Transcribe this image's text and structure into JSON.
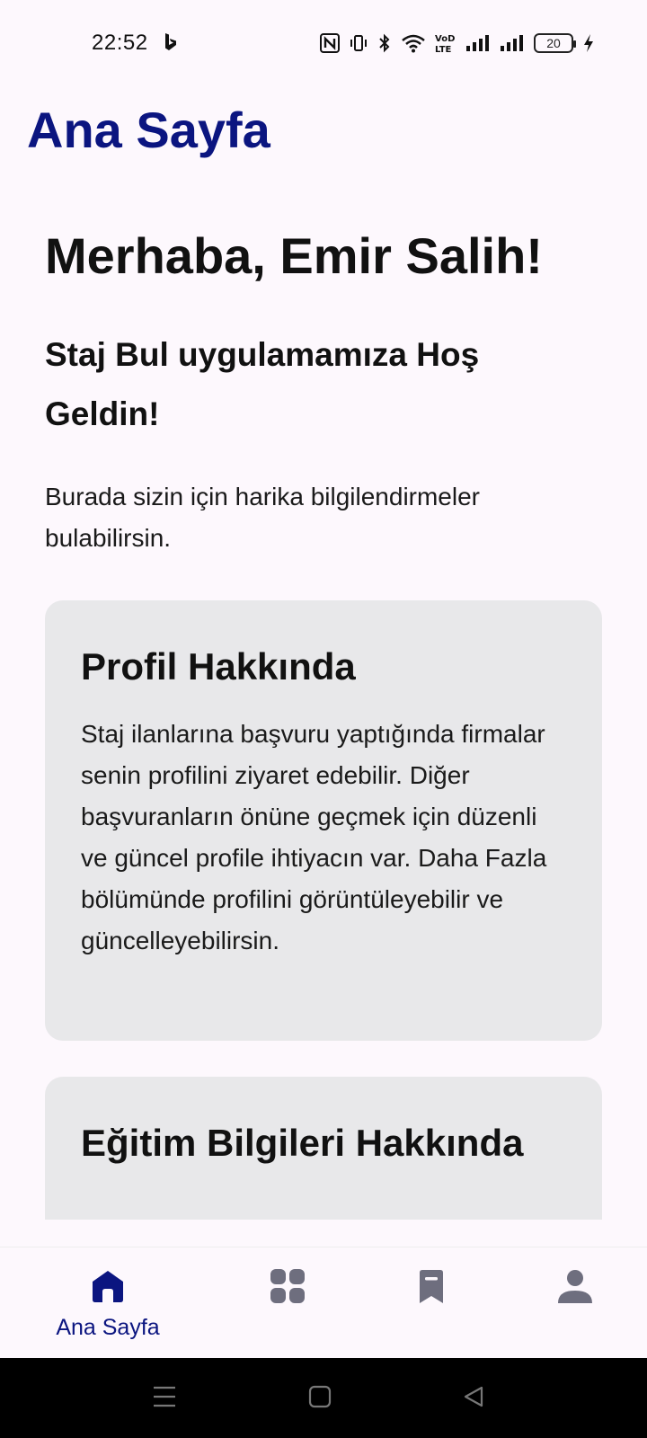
{
  "status_bar": {
    "time": "22:52",
    "battery_level": "20",
    "icons": [
      "bing-icon",
      "nfc-icon",
      "vibrate-icon",
      "bluetooth-icon",
      "wifi-icon",
      "volte-icon",
      "signal-icon",
      "signal-icon",
      "battery-icon",
      "charging-icon"
    ]
  },
  "header": {
    "title": "Ana Sayfa"
  },
  "main": {
    "greeting": "Merhaba, Emir Salih!",
    "welcome": "Staj Bul uygulamamıza Hoş Geldin!",
    "intro": "Burada sizin için harika bilgilendirmeler bulabilirsin.",
    "cards": [
      {
        "title": "Profil Hakkında",
        "body": "Staj ilanlarına başvuru yaptığında firmalar senin profilini ziyaret edebilir. Diğer başvuranların önüne geçmek için düzenli ve güncel profile ihtiyacın var. Daha Fazla bölümünde profilini görüntüleyebilir ve güncelleyebilirsin."
      },
      {
        "title": "Eğitim Bilgileri Hakkında",
        "body": ""
      }
    ]
  },
  "bottom_nav": {
    "items": [
      {
        "label": "Ana Sayfa",
        "icon": "home-icon",
        "active": true
      },
      {
        "label": "",
        "icon": "grid-icon",
        "active": false
      },
      {
        "label": "",
        "icon": "bookmark-icon",
        "active": false
      },
      {
        "label": "",
        "icon": "person-icon",
        "active": false
      }
    ],
    "active_color": "#0b1580",
    "inactive_color": "#6e6e7e"
  },
  "system_nav": {
    "buttons": [
      "menu-icon",
      "home-square-icon",
      "back-icon"
    ]
  },
  "colors": {
    "brand": "#0b1580",
    "background": "#fdf8fd",
    "card": "#e8e8ea"
  }
}
